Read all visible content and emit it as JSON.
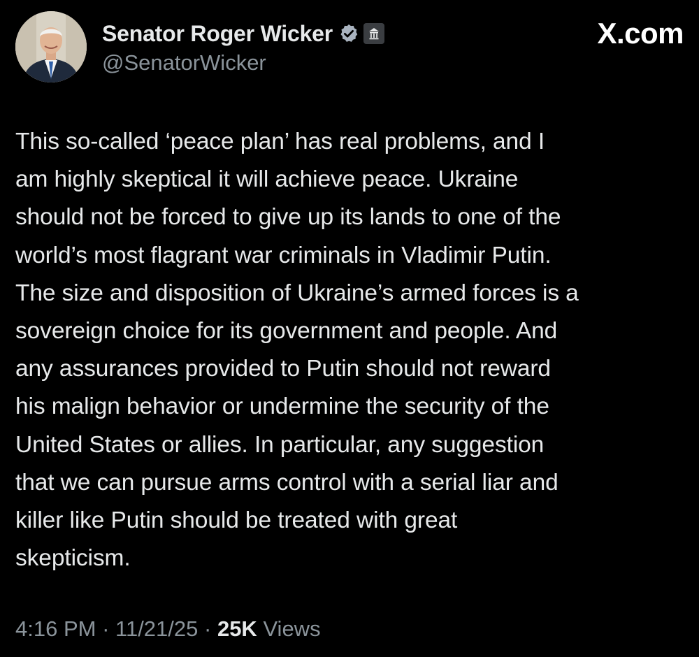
{
  "author": {
    "display_name": "Senator Roger Wicker",
    "handle": "@SenatorWicker",
    "verified_icon": "verified-badge-icon",
    "affiliation_icon": "government-building-icon"
  },
  "brand": {
    "label": "X.com"
  },
  "tweet": {
    "text": "This so-called ‘peace plan’ has real problems, and I\nam highly skeptical it will achieve peace. Ukraine\nshould not be forced to give up its lands to one of the\nworld’s most flagrant war criminals in Vladimir Putin.\nThe size and disposition of Ukraine’s armed forces is a\nsovereign choice for its government and people. And\nany assurances provided to Putin should not reward\nhis malign behavior or undermine the security of the\nUnited States or allies. In particular, any suggestion\nthat we can pursue arms control with a serial liar and\nkiller like Putin should be treated with great\nskepticism."
  },
  "meta": {
    "time": "4:16 PM",
    "separator": " · ",
    "date": "11/21/25",
    "views_count": "25K",
    "views_label": " Views"
  },
  "colors": {
    "background": "#000000",
    "primary_text": "#e7e9ea",
    "secondary_text": "#8b949b",
    "verified_blue": "#a9b3bf"
  }
}
